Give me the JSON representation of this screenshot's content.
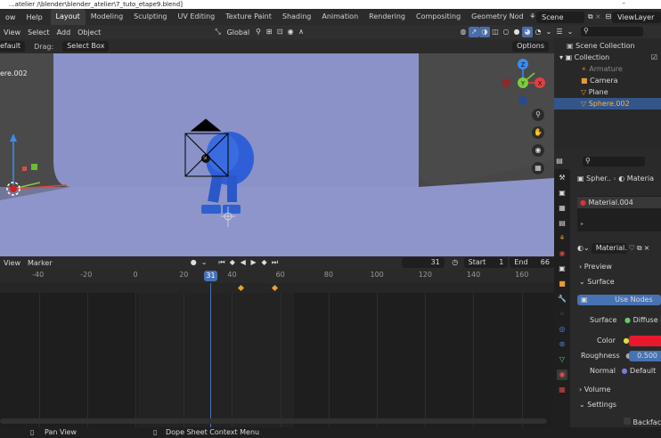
{
  "window": {
    "title": "...atelier /\\blender\\blender_atelier\\7_tuto_etape9.blend]"
  },
  "menubar": {
    "menus": [
      "ow",
      "Help"
    ],
    "tabs": [
      "Layout",
      "Modeling",
      "Sculpting",
      "UV Editing",
      "Texture Paint",
      "Shading",
      "Animation",
      "Rendering",
      "Compositing",
      "Geometry Nod"
    ],
    "active_tab": "Layout",
    "scene": "Scene",
    "view_layer": "ViewLayer"
  },
  "viewport": {
    "menus": [
      "View",
      "Select",
      "Add",
      "Object"
    ],
    "orientation": "Global",
    "mode_label": "efault",
    "drag_label": "Drag:",
    "drag_value": "Select Box",
    "options_label": "Options",
    "object_name": "ere.002",
    "gizmo_labels": {
      "z": "Z",
      "y": "Y",
      "x": "X"
    }
  },
  "outliner": {
    "root": "Scene Collection",
    "collection": "Collection",
    "items": [
      {
        "name": "Armature",
        "icon": "armature-icon",
        "selected": false
      },
      {
        "name": "Camera",
        "icon": "camera-icon",
        "selected": false
      },
      {
        "name": "Plane",
        "icon": "mesh-icon",
        "selected": false
      },
      {
        "name": "Sphere.002",
        "icon": "mesh-icon",
        "selected": true
      }
    ]
  },
  "properties": {
    "breadcrumb_object": "Spher..",
    "breadcrumb_material": "Materia",
    "material_slot": "Material.004",
    "material_name": "Material..",
    "sections": {
      "preview": "Preview",
      "surface": "Surface",
      "volume": "Volume",
      "settings": "Settings"
    },
    "use_nodes": "Use Nodes",
    "surface_label": "Surface",
    "surface_value": "Diffuse BS",
    "color_label": "Color",
    "color_value": "#e8192c",
    "roughness_label": "Roughness",
    "roughness_value": "0.500",
    "normal_label": "Normal",
    "normal_value": "Default",
    "backface_label": "Backfac"
  },
  "timeline": {
    "menus": [
      "View",
      "Marker"
    ],
    "current_frame": "31",
    "start_label": "Start",
    "start_value": "1",
    "end_label": "End",
    "end_value": "66",
    "ruler_ticks": [
      "-40",
      "-20",
      "0",
      "20",
      "40",
      "60",
      "80",
      "100",
      "120",
      "140",
      "160"
    ],
    "keyframes": [
      44,
      58
    ]
  },
  "statusbar": {
    "pan_view": "Pan View",
    "context_menu": "Dope Sheet Context Menu"
  }
}
